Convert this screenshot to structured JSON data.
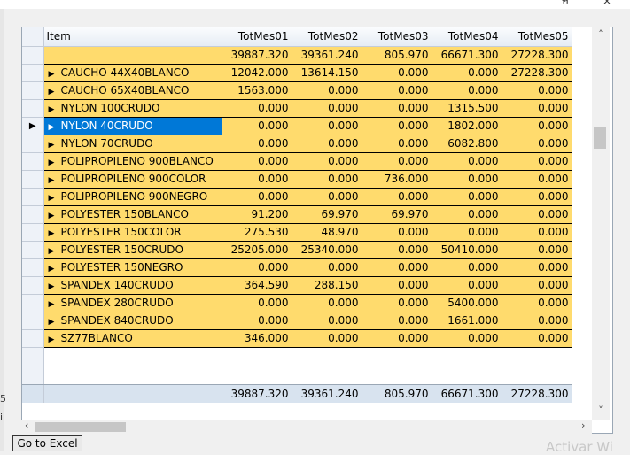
{
  "titlebar": {
    "close_glyph": "×",
    "glyph_left": "ׯ"
  },
  "left_fragments": [
    "5",
    "i"
  ],
  "grid": {
    "columns": [
      "Item",
      "TotMes01",
      "TotMes02",
      "TotMes03",
      "TotMes04",
      "TotMes05"
    ],
    "subtotal": [
      "",
      "39887.320",
      "39361.240",
      "805.970",
      "66671.300",
      "27228.300"
    ],
    "rows": [
      {
        "item": "CAUCHO 44X40BLANCO",
        "v": [
          "12042.000",
          "13614.150",
          "0.000",
          "0.000",
          "27228.300"
        ]
      },
      {
        "item": "CAUCHO 65X40BLANCO",
        "v": [
          "1563.000",
          "0.000",
          "0.000",
          "0.000",
          "0.000"
        ]
      },
      {
        "item": "NYLON 100CRUDO",
        "v": [
          "0.000",
          "0.000",
          "0.000",
          "1315.500",
          "0.000"
        ]
      },
      {
        "item": "NYLON 40CRUDO",
        "v": [
          "0.000",
          "0.000",
          "0.000",
          "1802.000",
          "0.000"
        ],
        "selected": true
      },
      {
        "item": "NYLON 70CRUDO",
        "v": [
          "0.000",
          "0.000",
          "0.000",
          "6082.800",
          "0.000"
        ]
      },
      {
        "item": "POLIPROPILENO 900BLANCO",
        "v": [
          "0.000",
          "0.000",
          "0.000",
          "0.000",
          "0.000"
        ]
      },
      {
        "item": "POLIPROPILENO 900COLOR",
        "v": [
          "0.000",
          "0.000",
          "736.000",
          "0.000",
          "0.000"
        ]
      },
      {
        "item": "POLIPROPILENO 900NEGRO",
        "v": [
          "0.000",
          "0.000",
          "0.000",
          "0.000",
          "0.000"
        ]
      },
      {
        "item": "POLYESTER 150BLANCO",
        "v": [
          "91.200",
          "69.970",
          "69.970",
          "0.000",
          "0.000"
        ]
      },
      {
        "item": "POLYESTER 150COLOR",
        "v": [
          "275.530",
          "48.970",
          "0.000",
          "0.000",
          "0.000"
        ]
      },
      {
        "item": "POLYESTER 150CRUDO",
        "v": [
          "25205.000",
          "25340.000",
          "0.000",
          "50410.000",
          "0.000"
        ]
      },
      {
        "item": "POLYESTER 150NEGRO",
        "v": [
          "0.000",
          "0.000",
          "0.000",
          "0.000",
          "0.000"
        ]
      },
      {
        "item": "SPANDEX 140CRUDO",
        "v": [
          "364.590",
          "288.150",
          "0.000",
          "0.000",
          "0.000"
        ]
      },
      {
        "item": "SPANDEX 280CRUDO",
        "v": [
          "0.000",
          "0.000",
          "0.000",
          "5400.000",
          "0.000"
        ]
      },
      {
        "item": "SPANDEX 840CRUDO",
        "v": [
          "0.000",
          "0.000",
          "0.000",
          "1661.000",
          "0.000"
        ]
      },
      {
        "item": "SZ77BLANCO",
        "v": [
          "346.000",
          "0.000",
          "0.000",
          "0.000",
          "0.000"
        ]
      }
    ],
    "total": [
      "39887.320",
      "39361.240",
      "805.970",
      "66671.300",
      "27228.300"
    ]
  },
  "icons": {
    "expand": "▶",
    "current_row": "▶",
    "scroll_up": "˄",
    "scroll_down": "˅",
    "scroll_left": "‹",
    "scroll_right": "›"
  },
  "buttons": {
    "excel": "Go to Excel"
  },
  "watermark": "Activar Wi",
  "colors": {
    "row_bg": "#ffdb6d",
    "selection": "#0078d7",
    "header_bg": "#e6ecf4",
    "total_bg": "#d8e3ef"
  }
}
